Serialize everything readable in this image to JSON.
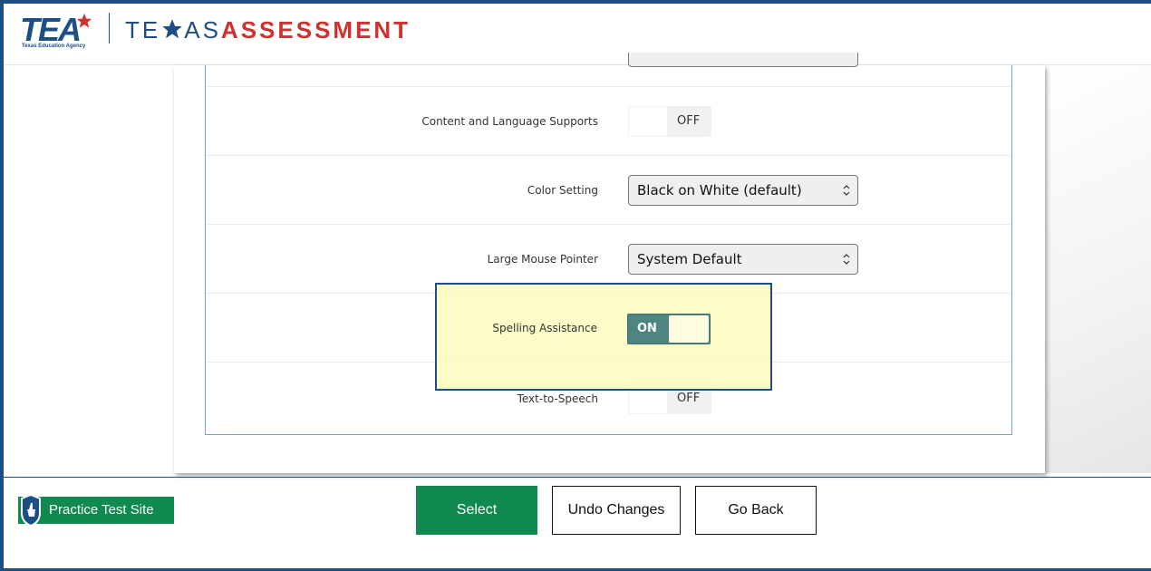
{
  "header": {
    "agency_logo_text": "TEA",
    "agency_name": "Texas Education Agency",
    "brand_part1": "TE",
    "brand_part2": "AS",
    "brand_part3": "ASSESSMENT"
  },
  "settings": {
    "rows": [
      {
        "label": "Content and Language Supports",
        "type": "toggle",
        "value": "OFF"
      },
      {
        "label": "Color Setting",
        "type": "select",
        "value": "Black on White (default)"
      },
      {
        "label": "Large Mouse Pointer",
        "type": "select",
        "value": "System Default"
      },
      {
        "label": "Spelling Assistance",
        "type": "toggle",
        "value": "ON"
      },
      {
        "label": "Text-to-Speech",
        "type": "toggle",
        "value": "OFF"
      }
    ]
  },
  "footer": {
    "practice_label": "Practice Test Site",
    "select_label": "Select",
    "undo_label": "Undo Changes",
    "back_label": "Go Back"
  },
  "colors": {
    "brand_blue": "#1c4f86",
    "brand_red": "#d0312d",
    "action_green": "#118a4f",
    "toggle_on": "#4e8582",
    "highlight": "#fcfbbe"
  },
  "icons": [
    "star-icon",
    "chevron-updown-icon",
    "practice-badge-icon"
  ]
}
